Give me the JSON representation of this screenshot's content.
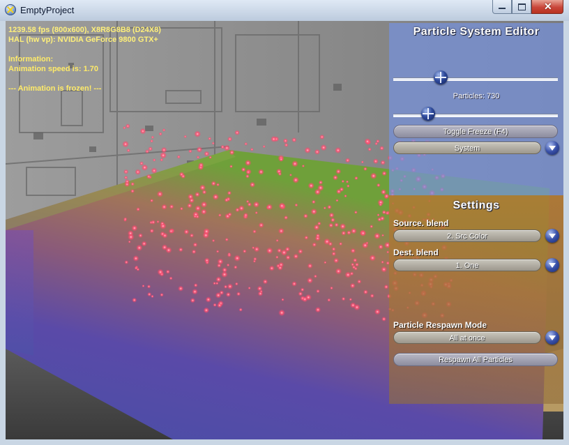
{
  "window": {
    "title": "EmptyProject",
    "icon": "directx-app-icon",
    "controls": {
      "minimize": "minimize-icon",
      "maximize": "maximize-icon",
      "close": "close-icon"
    }
  },
  "hud": {
    "stats_line1": "1239.58 fps (800x600), X8R8G8B8 (D24X8)",
    "stats_line2": "HAL (hw vp): NVIDIA GeForce 9800 GTX+",
    "info_heading": "Information:",
    "animation_speed": "Animation speed is: 1.70",
    "frozen_notice": "--- Animation is frozen! ---",
    "text_color": "#ffeb68"
  },
  "particle_editor": {
    "title": "Particle System Editor",
    "slider1_value": 0.29,
    "particles_label": "Particles: 730",
    "slider2_value": 0.21,
    "toggle_freeze_label": "Toggle Freeze (F4)",
    "system_combo_value": "System",
    "panel_color": "#7692dc"
  },
  "settings": {
    "title": "Settings",
    "source_blend_label": "Source. blend",
    "source_blend_value": "2. Src Color",
    "dest_blend_label": "Dest. blend",
    "dest_blend_value": "1. One",
    "respawn_mode_label": "Particle Respawn Mode",
    "respawn_mode_value": "All at once",
    "respawn_all_label": "Respawn All Particles",
    "panel_color": "#b27834"
  }
}
